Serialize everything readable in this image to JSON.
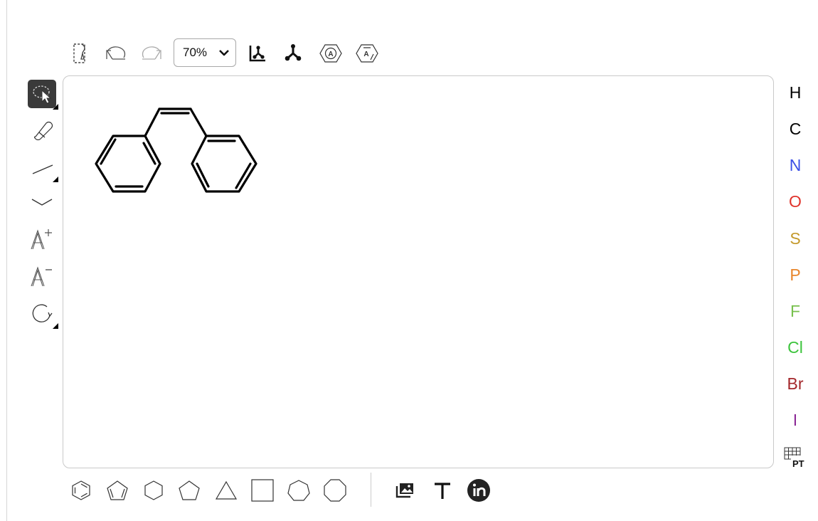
{
  "toolbar": {
    "items": [
      "clear-document",
      "undo",
      "redo",
      "zoom",
      "layout",
      "clean",
      "aromatize",
      "dearomatize"
    ],
    "zoom": {
      "selected": "70%"
    }
  },
  "left_tools": [
    "select-lasso",
    "erase",
    "single-bond",
    "chain",
    "charge-plus",
    "charge-minus",
    "rotate"
  ],
  "canvas": {
    "structure": "cis-stilbene",
    "bond_color": "#000000"
  },
  "elements": [
    {
      "symbol": "H",
      "color": "#000000"
    },
    {
      "symbol": "C",
      "color": "#000000"
    },
    {
      "symbol": "N",
      "color": "#3c50e6"
    },
    {
      "symbol": "O",
      "color": "#e0342c"
    },
    {
      "symbol": "S",
      "color": "#c49a2c"
    },
    {
      "symbol": "P",
      "color": "#e8862c"
    },
    {
      "symbol": "F",
      "color": "#78c04e"
    },
    {
      "symbol": "Cl",
      "color": "#3cc43c"
    },
    {
      "symbol": "Br",
      "color": "#a3262a"
    },
    {
      "symbol": "I",
      "color": "#8c2a96"
    }
  ],
  "periodic_table": {
    "label": "PT"
  },
  "bottom_tools": [
    "benzene",
    "cyclopentadiene",
    "cyclohexane",
    "cyclopentane",
    "cyclopropane",
    "cyclobutane",
    "cycloheptane",
    "cyclooctane",
    "image",
    "text",
    "ketcher-logo"
  ]
}
